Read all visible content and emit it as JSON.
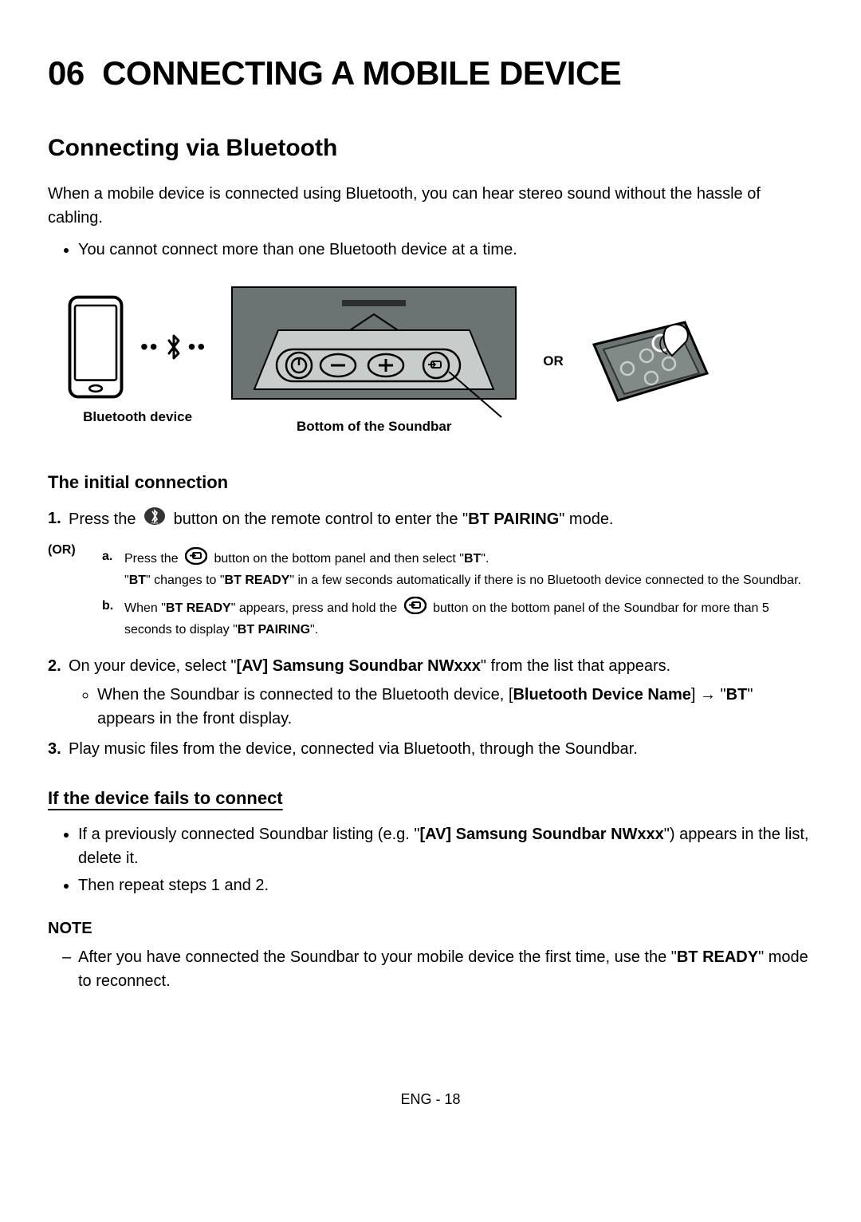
{
  "chapter": {
    "num": "06",
    "title": "CONNECTING A MOBILE DEVICE"
  },
  "section_title": "Connecting via Bluetooth",
  "intro": "When a mobile device is connected using Bluetooth, you can hear stereo sound without the hassle of cabling.",
  "intro_bullet": "You cannot connect more than one Bluetooth device at a time.",
  "diagram": {
    "bt_device_label": "Bluetooth device",
    "soundbar_label": "Bottom of the Soundbar",
    "or_label": "OR"
  },
  "sub_initial": "The initial connection",
  "step1_pre": "Press the ",
  "step1_post": " button on the remote control to enter the \"",
  "step1_mode": "BT PAIRING",
  "step1_end": "\" mode.",
  "or_inline": "(OR)",
  "step1a_pre": "Press the ",
  "step1a_mid": " button on the bottom panel and then select \"",
  "step1a_bt": "BT",
  "step1a_end": "\".",
  "step1a_line2_pre": "\"",
  "step1a_line2_bt": "BT",
  "step1a_line2_mid": "\" changes to \"",
  "step1a_line2_ready": "BT READY",
  "step1a_line2_end": "\" in a few seconds automatically if there is no Bluetooth device connected to the Soundbar.",
  "step1b_pre": "When \"",
  "step1b_ready": "BT READY",
  "step1b_mid": "\" appears, press and hold the ",
  "step1b_post": " button on the bottom panel of the Soundbar for more than 5 seconds to display \"",
  "step1b_pair": "BT PAIRING",
  "step1b_end": "\".",
  "step2_pre": "On your device, select \"",
  "step2_name": "[AV] Samsung Soundbar NWxxx",
  "step2_end": "\" from the list that appears.",
  "step2_bullet_pre": "When the Soundbar is connected to the Bluetooth device, [",
  "step2_bullet_name": "Bluetooth Device Name",
  "step2_bullet_mid": "] → \"",
  "step2_bullet_bt": "BT",
  "step2_bullet_end": "\" appears in the front display.",
  "step3": "Play music files from the device, connected via Bluetooth, through the Soundbar.",
  "sub_fail": "If the device fails to connect",
  "fail_b1_pre": "If a previously connected Soundbar listing (e.g. \"",
  "fail_b1_name": "[AV] Samsung Soundbar NWxxx",
  "fail_b1_end": "\") appears in the list, delete it.",
  "fail_b2": "Then repeat steps 1 and 2.",
  "note_heading": "NOTE",
  "note_pre": "After you have connected the Soundbar to your mobile device the first time, use the \"",
  "note_ready": "BT READY",
  "note_end": "\" mode to reconnect.",
  "footer": "ENG - 18"
}
